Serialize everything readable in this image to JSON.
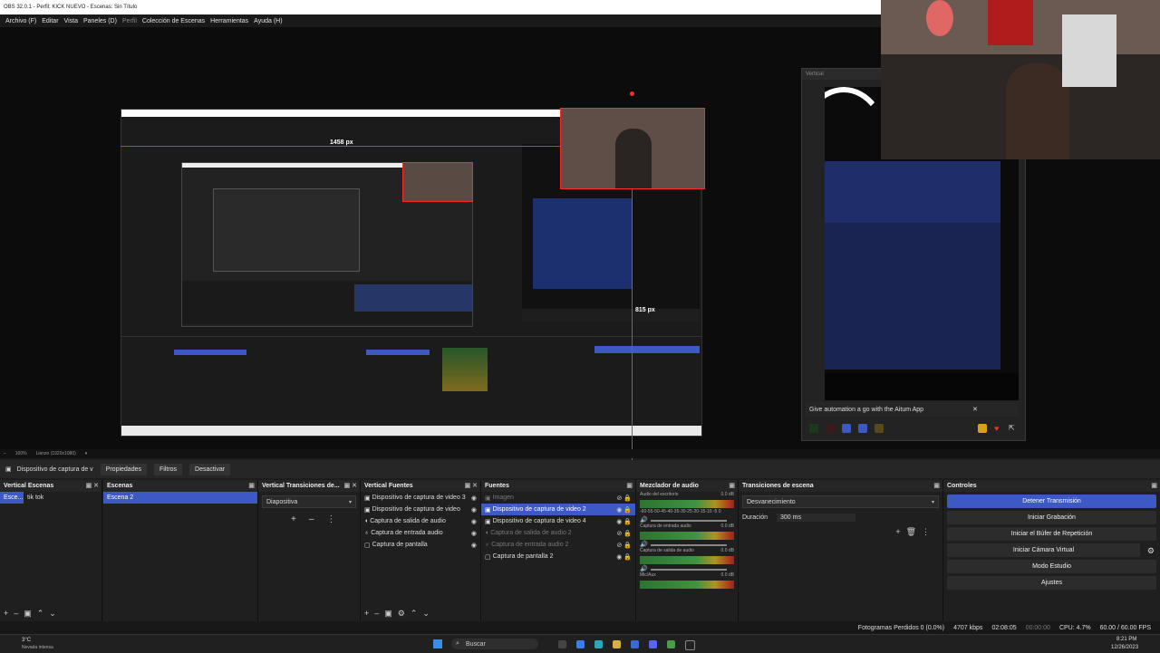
{
  "window": {
    "title": "OBS 32.0.1 - Perfil: KICK NUEVO - Escenas: Sin Título",
    "minimize": "–",
    "maximize": "□",
    "close": "✕"
  },
  "menu": [
    "Archivo (F)",
    "Editar",
    "Vista",
    "Paneles (D)",
    "Perfil",
    "Colección de Escenas",
    "Herramientas",
    "Ayuda (H)"
  ],
  "preview": {
    "measure_h": "1458 px",
    "measure_v": "815 px",
    "zoom": "100%",
    "lienzo": "Lienzo (1920x1080)"
  },
  "vertical_preview": {
    "title": "Vertical",
    "banner": "Give automation a go with the Aitum App",
    "banner_close": "✕"
  },
  "context_bar": {
    "source": "Dispositivo de captura de v",
    "properties": "Propiedades",
    "filters": "Filtros",
    "deactivate": "Desactivar"
  },
  "docks": {
    "vertical_scenes": {
      "title": "Vertical Escenas",
      "items": [
        "Esce...",
        "tik tok"
      ]
    },
    "scenes": {
      "title": "Escenas",
      "items": [
        "Escena 2"
      ]
    },
    "vertical_transitions": {
      "title": "Vertical Transiciones de...",
      "selected": "Diapositiva"
    },
    "vertical_sources": {
      "title": "Vertical Fuentes",
      "items": [
        "Dispositivo de captura de video 3",
        "Dispositivo de captura de video",
        "Captura de salida de audio",
        "Captura de entrada audio",
        "Captura de pantalla"
      ]
    },
    "sources": {
      "title": "Fuentes",
      "items": [
        "Imagen",
        "Dispositivo de captura de video 2",
        "Dispositivo de captura de video 4",
        "Captura de salida de audio 2",
        "Captura de entrada audio 2",
        "Captura de pantalla 2"
      ]
    },
    "mixer": {
      "title": "Mezclador de audio",
      "channels": [
        {
          "name": "Audio del escritorio",
          "db": "0.0 dB"
        },
        {
          "name": "Captura de entrada audio",
          "db": "0.0 dB"
        },
        {
          "name": "Captura de salida de audio",
          "db": "0.0 dB"
        },
        {
          "name": "Mic/Aux",
          "db": "0.0 dB"
        }
      ],
      "scale": "-60-55-50-45-40-35-30-25-20-15-10 -5 0"
    },
    "transitions": {
      "title": "Transiciones de escena",
      "selected": "Desvanecimiento",
      "duration_label": "Duración",
      "duration_value": "300 ms"
    },
    "controls": {
      "title": "Controles",
      "buttons": [
        "Detener Transmisión",
        "Iniciar Grabación",
        "Iniciar el Búfer de Repetición",
        "Iniciar Cámara Virtual",
        "Modo Estudio",
        "Ajustes"
      ]
    }
  },
  "status": {
    "dropped": "Fotogramas Perdidos 0 (0.0%)",
    "kbps": "4707 kbps",
    "stream_time": "02:08:05",
    "rec_time": "00:00:00",
    "cpu": "CPU: 4.7%",
    "fps": "60.00 / 60.00 FPS"
  },
  "taskbar": {
    "weather_temp": "3°C",
    "weather_desc": "Nevada intensa",
    "search": "Buscar",
    "time": "8:21 PM",
    "date": "12/26/2023"
  },
  "colors": {
    "accent": "#3c59c4",
    "record_red": "#ff2a2a",
    "bg": "#1d1d1d"
  }
}
